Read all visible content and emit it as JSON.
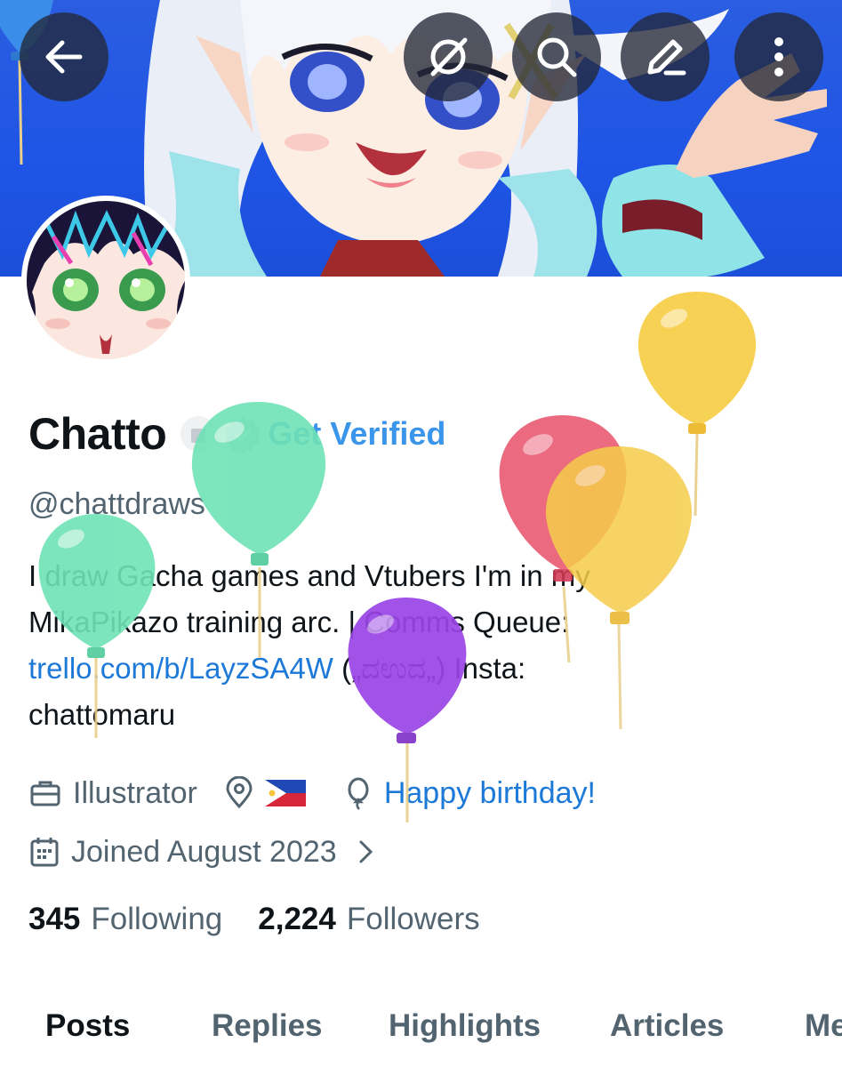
{
  "header": {
    "back_icon": "arrow-left-icon",
    "actions": [
      "grok-icon",
      "search-icon",
      "edit-icon",
      "more-vertical-icon"
    ]
  },
  "profile": {
    "display_name": "Chatto",
    "get_verified": "Get Verified",
    "handle": "@chattdraws",
    "bio_line1": "I draw Gacha games and Vtubers  I'm in my",
    "bio_line2": "MikaPikazo training arc. | Comms Queue:",
    "bio_link": "trello.com/b/LayzSA4W",
    "bio_line3_rest": "  („ದಉದ„)  Insta:",
    "bio_line4": "chattomaru",
    "job": "Illustrator",
    "location_flag": "🇵🇭",
    "birthday": "Happy birthday!",
    "joined": "Joined August 2023"
  },
  "stats": {
    "following_count": "345",
    "following_label": "Following",
    "followers_count": "2,224",
    "followers_label": "Followers"
  },
  "tabs": [
    {
      "label": "Posts"
    },
    {
      "label": "Replies"
    },
    {
      "label": "Highlights"
    },
    {
      "label": "Articles"
    },
    {
      "label": "Me"
    }
  ],
  "colors": {
    "banner_blue": "#1f55e6",
    "link_blue": "#1d79d8",
    "verified_blue": "#3b95ea",
    "balloon_green": "#6fe3b6",
    "balloon_red": "#e9566f",
    "balloon_yellow": "#f5cc4a",
    "balloon_purple": "#9a45e6"
  }
}
